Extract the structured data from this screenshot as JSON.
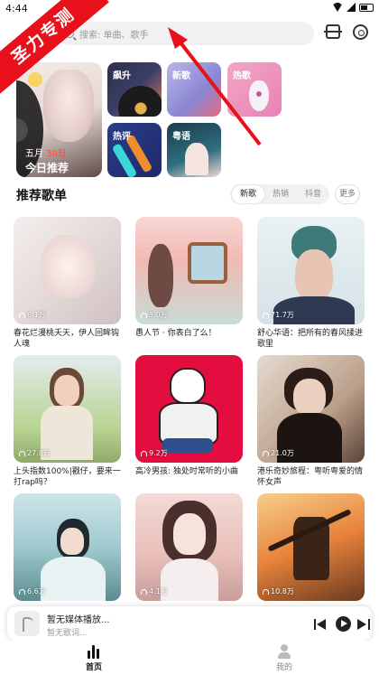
{
  "status": {
    "time": "4:44"
  },
  "watermark": "圣力专测",
  "search": {
    "placeholder": "搜索: 单曲、歌手"
  },
  "banner": {
    "today": {
      "date_month": "五月",
      "date_day": "30日",
      "label": "今日推荐"
    },
    "categories": [
      "飙升",
      "新歌",
      "热歌",
      "热评",
      "粤语"
    ]
  },
  "section": {
    "title": "推荐歌单",
    "tabs": [
      "新歌",
      "热销",
      "抖音"
    ],
    "active_tab": "新歌",
    "more": "更多"
  },
  "playlists": [
    {
      "count": "6.1万",
      "title": "春花烂漫桃夭天，伊人回眸钩人魂"
    },
    {
      "count": "5.0万",
      "title": "愚人节 · 你表白了么！"
    },
    {
      "count": "71.7万",
      "title": "舒心华语：把所有的春风揉进歌里"
    },
    {
      "count": "27.8万",
      "title": "上头指数100%|戳仔，要来一打rap吗？"
    },
    {
      "count": "9.2万",
      "title": "高冷男孩: 独处时常听的小曲"
    },
    {
      "count": "21.0万",
      "title": "港乐奇妙旅程：粤听粤爱的情怀女声"
    },
    {
      "count": "6.6万",
      "title": ""
    },
    {
      "count": "4.1万",
      "title": ""
    },
    {
      "count": "10.8万",
      "title": ""
    }
  ],
  "player": {
    "song": "暂无媒体播放...",
    "lyric": "暂无歌词..."
  },
  "nav": {
    "home": "首页",
    "mine": "我的"
  }
}
